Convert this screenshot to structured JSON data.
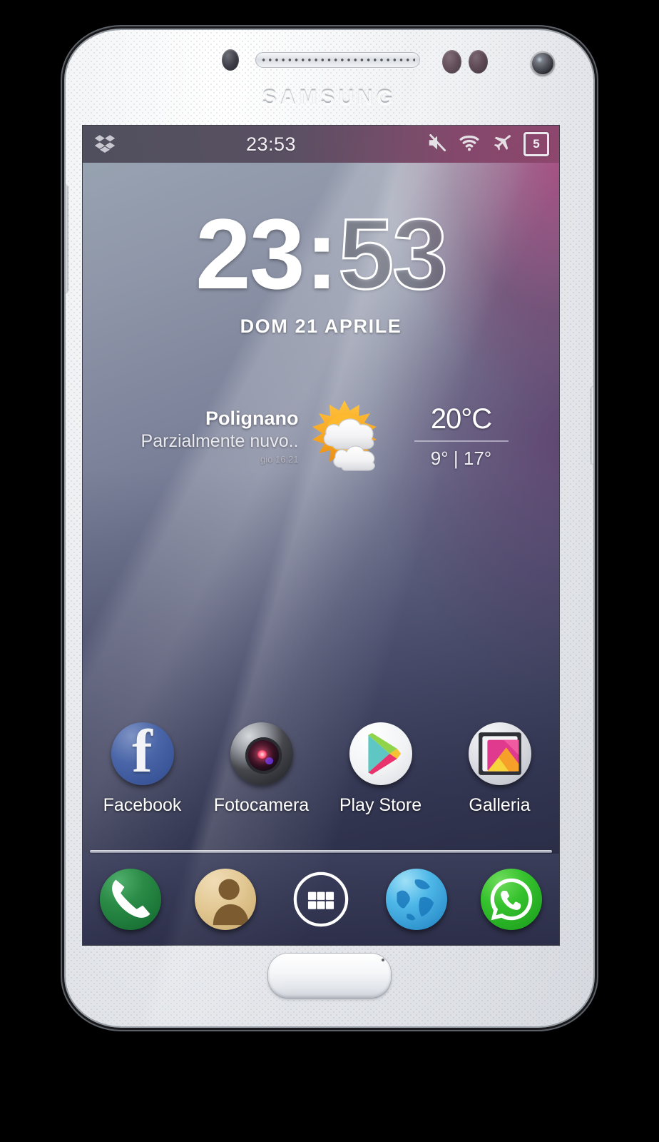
{
  "device": {
    "brand": "SAMSUNG",
    "hardware": {
      "sensor": "proximity-sensor",
      "earpiece": "earpiece-speaker",
      "front_camera": "front-camera",
      "home_button": "home-button",
      "volume_button": "volume-rocker",
      "power_button": "power-button"
    }
  },
  "statusbar": {
    "time": "23:53",
    "left_icons": [
      {
        "name": "dropbox-icon",
        "label": "Dropbox"
      }
    ],
    "right_icons": [
      {
        "name": "mute-icon",
        "label": "Silenzioso"
      },
      {
        "name": "wifi-icon",
        "label": "Wi-Fi"
      },
      {
        "name": "airplane-mode-icon",
        "label": "Modalità aereo"
      }
    ],
    "notification_count": "5"
  },
  "clock": {
    "hours": "23",
    "separator": ":",
    "minutes": "53",
    "date": "DOM 21 APRILE"
  },
  "weather": {
    "city": "Polignano",
    "condition": "Parzialmente nuvo..",
    "updated": "gio 16:21",
    "temperature": "20°C",
    "low": "9°",
    "range_separator": "|",
    "high": "17°",
    "range": "9° | 17°",
    "icon": "sun-behind-cloud-icon"
  },
  "apps": [
    {
      "label": "Facebook",
      "icon": "facebook-icon"
    },
    {
      "label": "Fotocamera",
      "icon": "camera-icon"
    },
    {
      "label": "Play Store",
      "icon": "play-store-icon"
    },
    {
      "label": "Galleria",
      "icon": "gallery-icon"
    }
  ],
  "dock": [
    {
      "label": "Telefono",
      "icon": "phone-icon"
    },
    {
      "label": "Contatti",
      "icon": "contacts-icon"
    },
    {
      "label": "Applicazioni",
      "icon": "app-drawer-icon"
    },
    {
      "label": "Internet",
      "icon": "browser-globe-icon"
    },
    {
      "label": "WhatsApp",
      "icon": "whatsapp-icon"
    }
  ],
  "colors": {
    "statusbar_left": "#4a4856",
    "statusbar_right": "#8c466c",
    "wallpaper_light": "#9aa6b4",
    "wallpaper_dark": "#33364f",
    "accent_purple": "#a64a80",
    "text_primary": "#ffffff",
    "sun_orange": "#f5a623",
    "whatsapp_green": "#36c22e",
    "phone_green": "#2a8b46"
  }
}
